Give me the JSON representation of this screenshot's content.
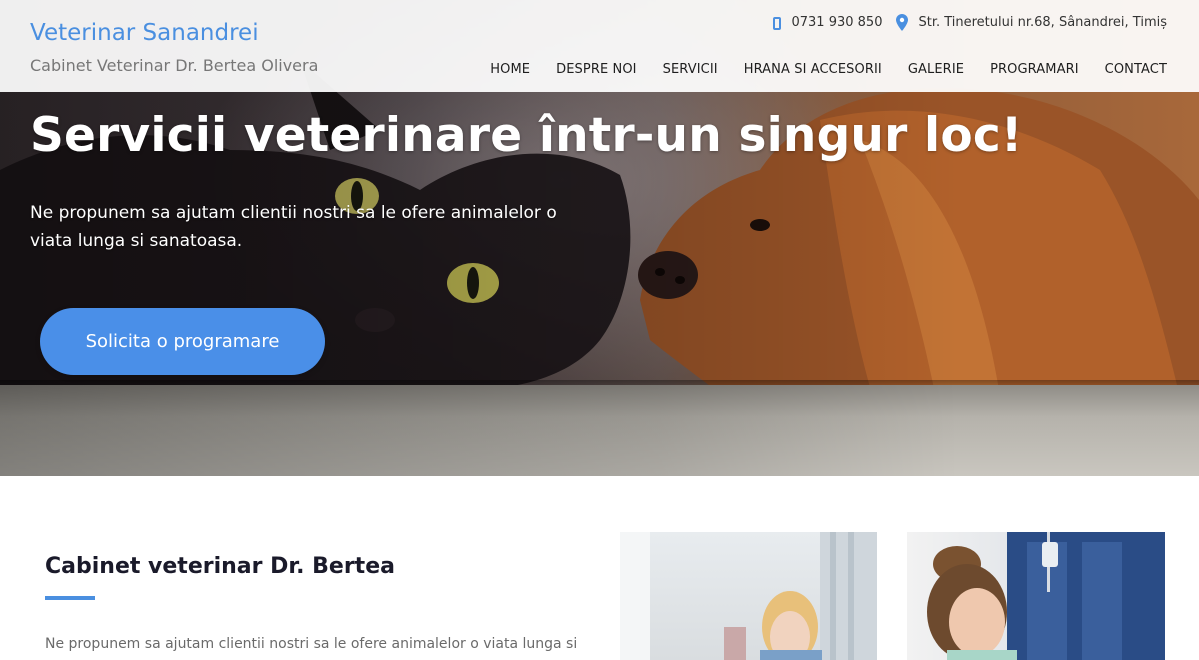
{
  "header": {
    "brand_title": "Veterinar Sanandrei",
    "brand_subtitle": "Cabinet Veterinar Dr. Bertea Olivera",
    "phone": "0731 930 850",
    "address": "Str. Tineretului nr.68, Sânandrei, Timiș",
    "phone_icon": "smartphone-icon",
    "address_icon": "map-pin-icon"
  },
  "nav": {
    "items": [
      {
        "label": "HOME"
      },
      {
        "label": "DESPRE NOI"
      },
      {
        "label": "SERVICII"
      },
      {
        "label": "HRANA SI ACCESORII"
      },
      {
        "label": "GALERIE"
      },
      {
        "label": "PROGRAMARI"
      },
      {
        "label": "CONTACT"
      }
    ]
  },
  "hero": {
    "title": "Servicii veterinare într-un singur loc!",
    "text": "Ne propunem sa ajutam clientii nostri sa le ofere animalelor o viata lunga si sanatoasa.",
    "cta_label": "Solicita o programare"
  },
  "about": {
    "heading": "Cabinet veterinar Dr. Bertea",
    "text": "Ne propunem sa ajutam clientii nostri sa le ofere animalelor o viata lunga si sanatoasa, oferind servicii veterinare complete intr-un singur loc."
  },
  "colors": {
    "accent": "#4a8fe0",
    "button": "#4a8fe8",
    "heading": "#1a1a2a",
    "body_text": "#6a6a6a"
  }
}
